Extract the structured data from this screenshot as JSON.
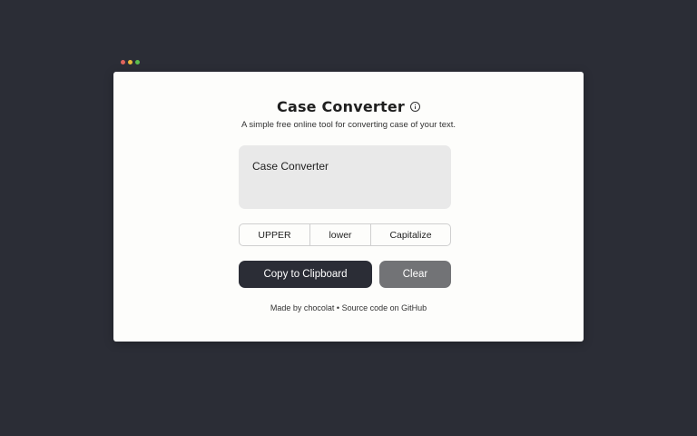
{
  "window_controls": {
    "close_color": "#e0645c",
    "minimize_color": "#e8b93a",
    "zoom_color": "#5bbd4e"
  },
  "app": {
    "title": "Case Converter",
    "subtitle": "A simple free online tool for converting case of your text."
  },
  "editor": {
    "value": "Case Converter"
  },
  "case_options": {
    "upper": "UPPER",
    "lower": "lower",
    "capitalize": "Capitalize"
  },
  "actions": {
    "copy": "Copy to Clipboard",
    "clear": "Clear",
    "copy_color": "#2b2d36",
    "clear_color": "#727376"
  },
  "footer": {
    "made_by_prefix": "Made by ",
    "author": "chocolat",
    "separator": " • ",
    "source_link": "Source code on GitHub"
  },
  "icons": {
    "info": "info-circle-icon"
  }
}
